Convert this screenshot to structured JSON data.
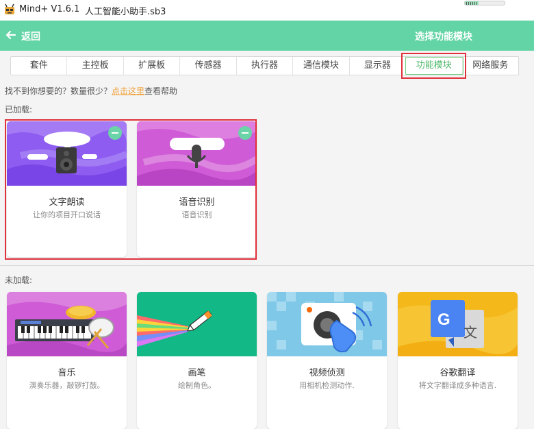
{
  "window": {
    "app_name": "Mind+ V1.6.1",
    "file_name": "人工智能小助手.sb3",
    "battery_level": 0.35
  },
  "header": {
    "back_label": "返回",
    "title": "选择功能模块",
    "color": "#63d4a5"
  },
  "tabs": [
    {
      "label": "套件"
    },
    {
      "label": "主控板"
    },
    {
      "label": "扩展板"
    },
    {
      "label": "传感器"
    },
    {
      "label": "执行器"
    },
    {
      "label": "通信模块"
    },
    {
      "label": "显示器"
    },
    {
      "label": "功能模块",
      "active": true
    },
    {
      "label": "网络服务"
    }
  ],
  "help": {
    "prefix": "找不到你想要的？数量很少？",
    "link": "点击这里",
    "suffix": "查看帮助"
  },
  "sections": {
    "loaded": "已加载:",
    "unloaded": "未加载:"
  },
  "loaded_modules": [
    {
      "title": "文字朗读",
      "desc": "让你的项目开口说话",
      "icon": "speaker-icon"
    },
    {
      "title": "语音识别",
      "desc": "语音识别",
      "icon": "microphone-icon"
    }
  ],
  "unloaded_modules": [
    {
      "title": "音乐",
      "desc": "演奏乐器，敲锣打鼓。",
      "icon": "keyboard-drum-icon"
    },
    {
      "title": "画笔",
      "desc": "绘制角色。",
      "icon": "pen-icon"
    },
    {
      "title": "视频侦测",
      "desc": "用相机检测动作.",
      "icon": "camera-hand-icon"
    },
    {
      "title": "谷歌翻译",
      "desc": "将文字翻译成多种语言.",
      "icon": "google-translate-icon"
    }
  ]
}
